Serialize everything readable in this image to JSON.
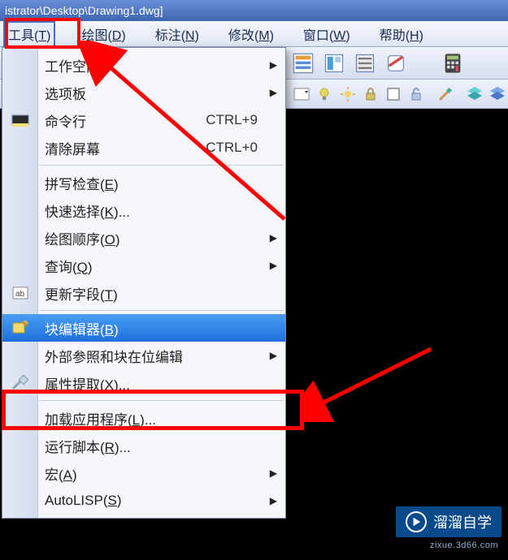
{
  "title_fragment": "istrator\\Desktop\\Drawing1.dwg]",
  "menubar": {
    "tools": {
      "label": "工具",
      "hotkey": "T"
    },
    "draw": {
      "label": "绘图",
      "hotkey": "D"
    },
    "annotate": {
      "label": "标注",
      "hotkey": "N"
    },
    "modify": {
      "label": "修改",
      "hotkey": "M"
    },
    "window": {
      "label": "窗口",
      "hotkey": "W"
    },
    "help": {
      "label": "帮助",
      "hotkey": "H"
    }
  },
  "menu": {
    "workspace": "工作空间",
    "palettes": "选项板",
    "commandline": "命令行",
    "commandline_shortcut": "CTRL+9",
    "cleanscreen": "清除屏幕",
    "cleanscreen_shortcut": "CTRL+0",
    "spellcheck": {
      "label": "拼写检查",
      "hotkey": "E"
    },
    "quickselect": {
      "label": "快速选择",
      "hotkey": "K",
      "suffix": "..."
    },
    "draworder": {
      "label": "绘图顺序",
      "hotkey": "O"
    },
    "inquiry": {
      "label": "查询",
      "hotkey": "Q"
    },
    "updatefields": {
      "label": "更新字段",
      "hotkey": "T"
    },
    "blockeditor": {
      "label": "块编辑器",
      "hotkey": "B"
    },
    "xrefinplace": "外部参照和块在位编辑",
    "attrextract": {
      "label": "属性提取",
      "hotkey": "X",
      "suffix": "..."
    },
    "loadapp": {
      "label": "加载应用程序",
      "hotkey": "L",
      "suffix": "..."
    },
    "runscript": {
      "label": "运行脚本",
      "hotkey": "R",
      "suffix": "..."
    },
    "macro": {
      "label": "宏",
      "hotkey": "A"
    },
    "autolisp": {
      "label": "AutoLISP",
      "hotkey": "S"
    }
  },
  "watermark": {
    "brand": "溜溜自学",
    "sub": "zixue.3d66.com"
  },
  "toolbar_icons": {
    "props": "props-icon",
    "sheet": "sheet-icon",
    "db": "db-icon",
    "tool": "tool-icon",
    "calc": "calc-icon",
    "layer": "layer-icon",
    "lock": "lock-icon",
    "color": "color-icon",
    "unlock": "unlock-icon",
    "match": "match-icon",
    "cyan": "cyan-stack-icon",
    "blue": "blue-stack-icon"
  }
}
